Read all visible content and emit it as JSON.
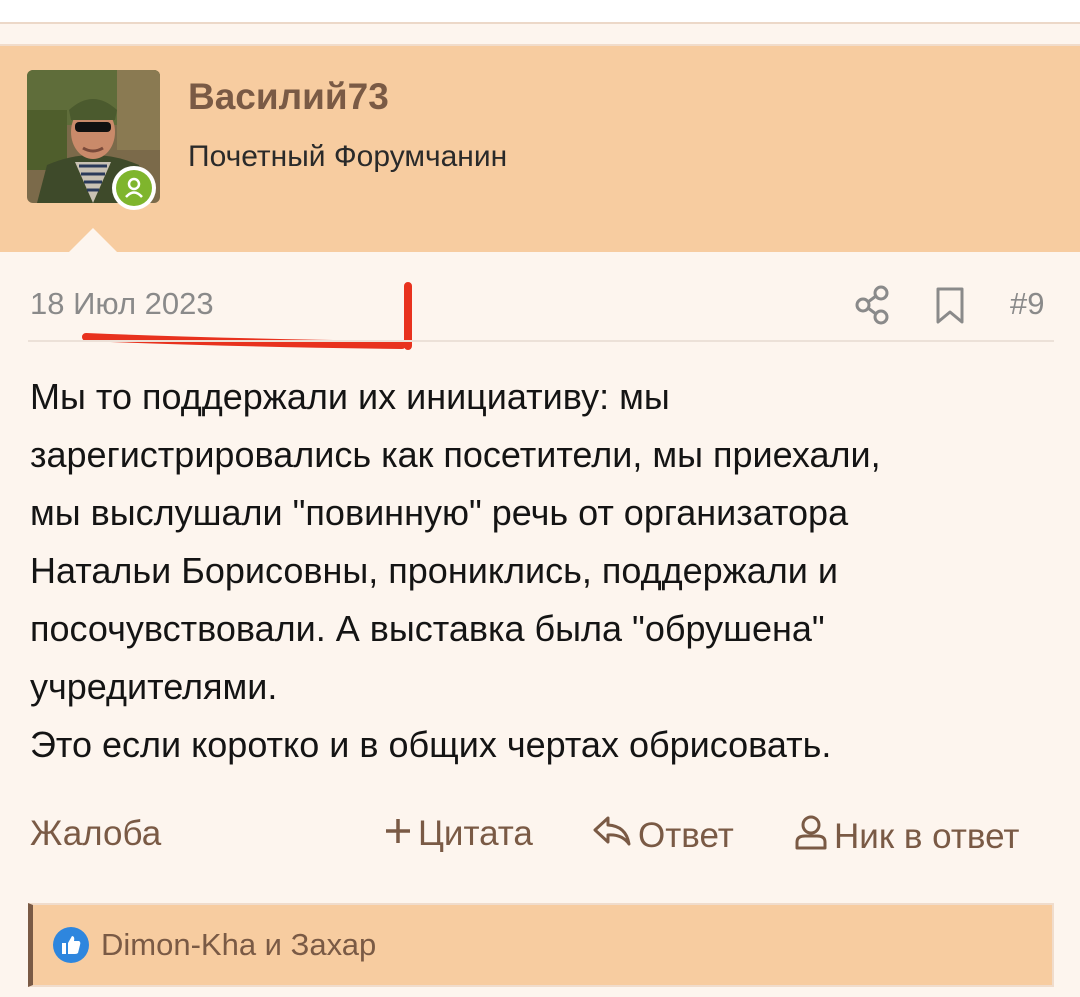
{
  "user": {
    "username": "Василий73",
    "title": "Почетный Форумчанин",
    "online": true
  },
  "post": {
    "date": "18 Июл 2023",
    "number": "#9",
    "body": [
      "Мы то поддержали их инициативу: мы",
      "зарегистрировались как посетители, мы приехали,",
      "мы выслушали \"повинную\" речь от организатора",
      "Натальи Борисовны, прониклись, поддержали и",
      "посочувствовали. А выставка была \"обрушена\"",
      "учредителями.",
      "Это если коротко и в общих чертах обрисовать."
    ]
  },
  "actions": {
    "report": "Жалоба",
    "quote": "Цитата",
    "reply": "Ответ",
    "mention": "Ник в ответ"
  },
  "reactions": {
    "text": "Dimon-Kha и Захар"
  },
  "colors": {
    "header_bg": "#f7cca0",
    "page_bg": "#fdf5ee",
    "accent_brown": "#7a5a45",
    "muted_gray": "#8a8a8a",
    "annotation_red": "#e8321e",
    "online_green": "#7fb52d",
    "like_blue": "#2e86de"
  },
  "icons": {
    "share": "share-icon",
    "bookmark": "bookmark-icon",
    "quote": "plus-icon",
    "reply": "reply-arrow-icon",
    "mention": "user-icon",
    "reaction": "thumbs-up-icon",
    "status": "online-user-icon"
  }
}
